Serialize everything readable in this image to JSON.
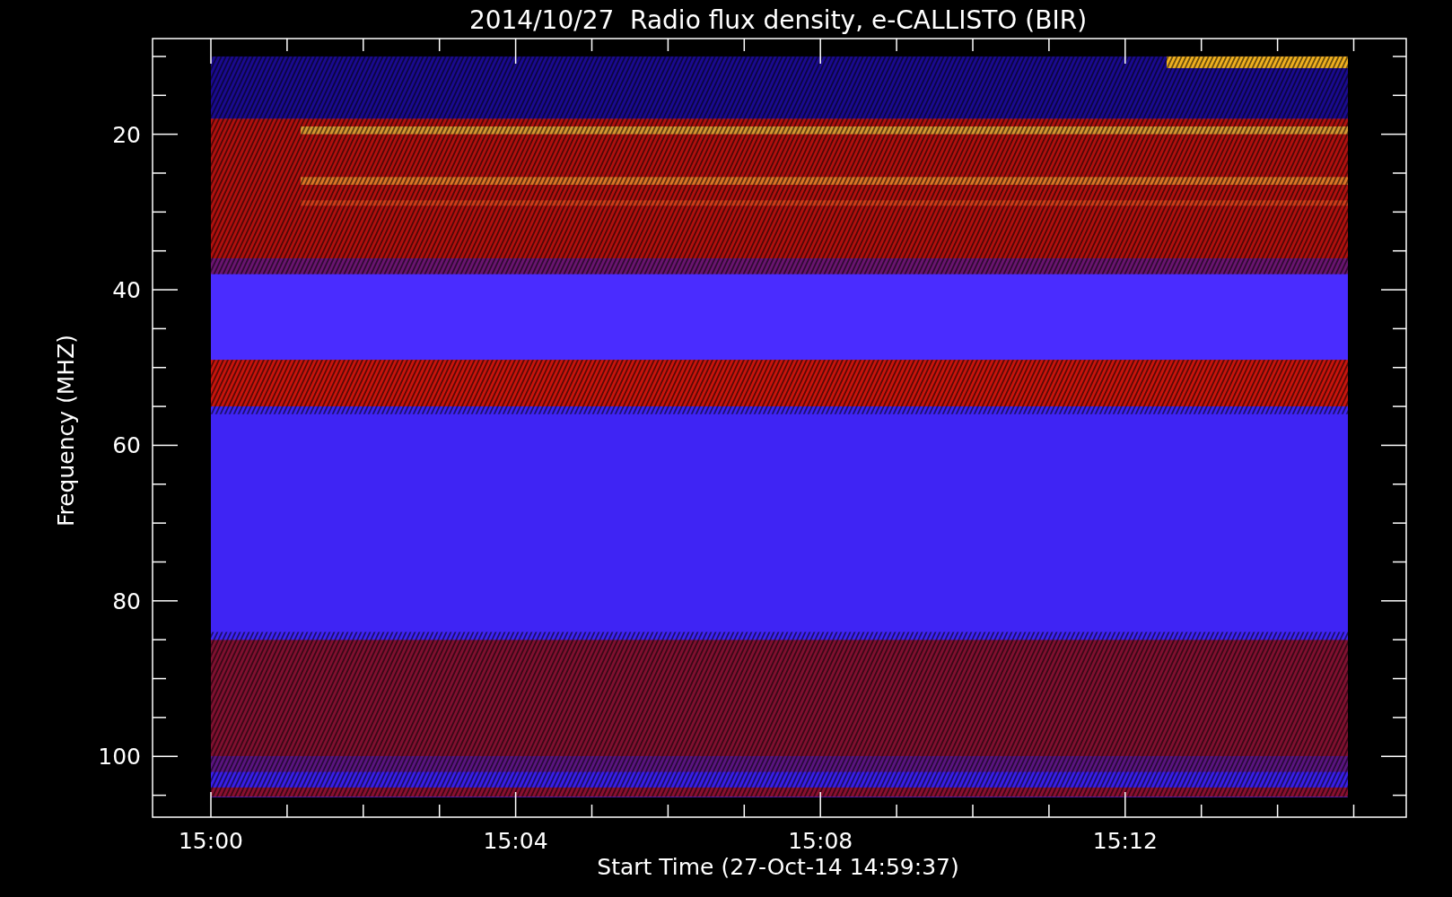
{
  "title": "2014/10/27  Radio flux density, e-CALLISTO (BIR)",
  "y_axis": {
    "label": "Frequency (MHZ)",
    "ticks": [
      "20",
      "40",
      "60",
      "80",
      "100"
    ]
  },
  "x_axis": {
    "label": "Start Time (27-Oct-14 14:59:37)",
    "ticks": [
      "15:00",
      "15:04",
      "15:08",
      "15:12"
    ]
  }
}
